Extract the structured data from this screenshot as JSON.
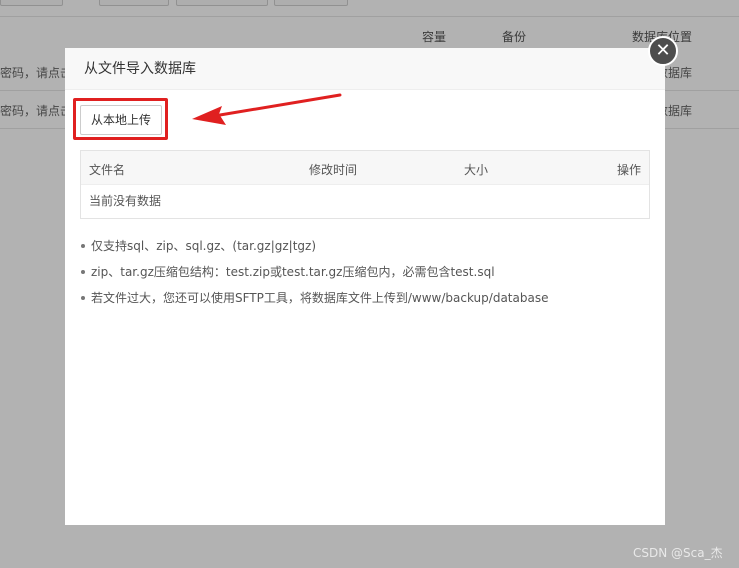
{
  "background": {
    "columns": [
      "容量",
      "备份",
      "数据库位置"
    ],
    "rows": [
      {
        "left_text": "密码，请点击",
        "right_text": "数据库"
      },
      {
        "left_text": "密码，请点击",
        "right_text": "数据库"
      }
    ]
  },
  "dialog": {
    "title": "从文件导入数据库",
    "close_symbol": "✕",
    "upload_label": "从本地上传",
    "table": {
      "headers": [
        "文件名",
        "修改时间",
        "大小",
        "操作"
      ],
      "empty_text": "当前没有数据"
    },
    "notes": [
      "仅支持sql、zip、sql.gz、(tar.gz|gz|tgz)",
      "zip、tar.gz压缩包结构：test.zip或test.tar.gz压缩包内，必需包含test.sql",
      "若文件过大，您还可以使用SFTP工具，将数据库文件上传到/www/backup/database"
    ]
  },
  "colors": {
    "highlight": "#e02020",
    "arrow": "#e02020",
    "overlay": "rgba(0,0,0,0.3)"
  },
  "watermark": "CSDN @Sca_杰"
}
